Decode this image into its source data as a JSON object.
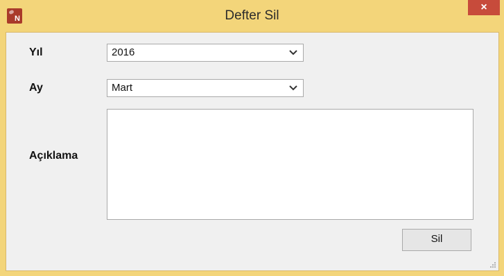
{
  "window": {
    "title": "Defter Sil",
    "app_icon_letter": "N",
    "close_glyph": "×",
    "icon": "app-n-icon"
  },
  "form": {
    "year": {
      "label": "Yıl",
      "value": "2016"
    },
    "month": {
      "label": "Ay",
      "value": "Mart"
    },
    "description": {
      "label": "Açıklama",
      "value": ""
    },
    "delete_button_label": "Sil"
  },
  "colors": {
    "titlebar": "#f3d57a",
    "client": "#f0f0f0",
    "close": "#c74b3b",
    "icon_bg": "#a93a2a"
  },
  "icons": {
    "dropdown": "chevron-down-icon",
    "close": "close-icon",
    "resize": "resize-grip-icon"
  }
}
